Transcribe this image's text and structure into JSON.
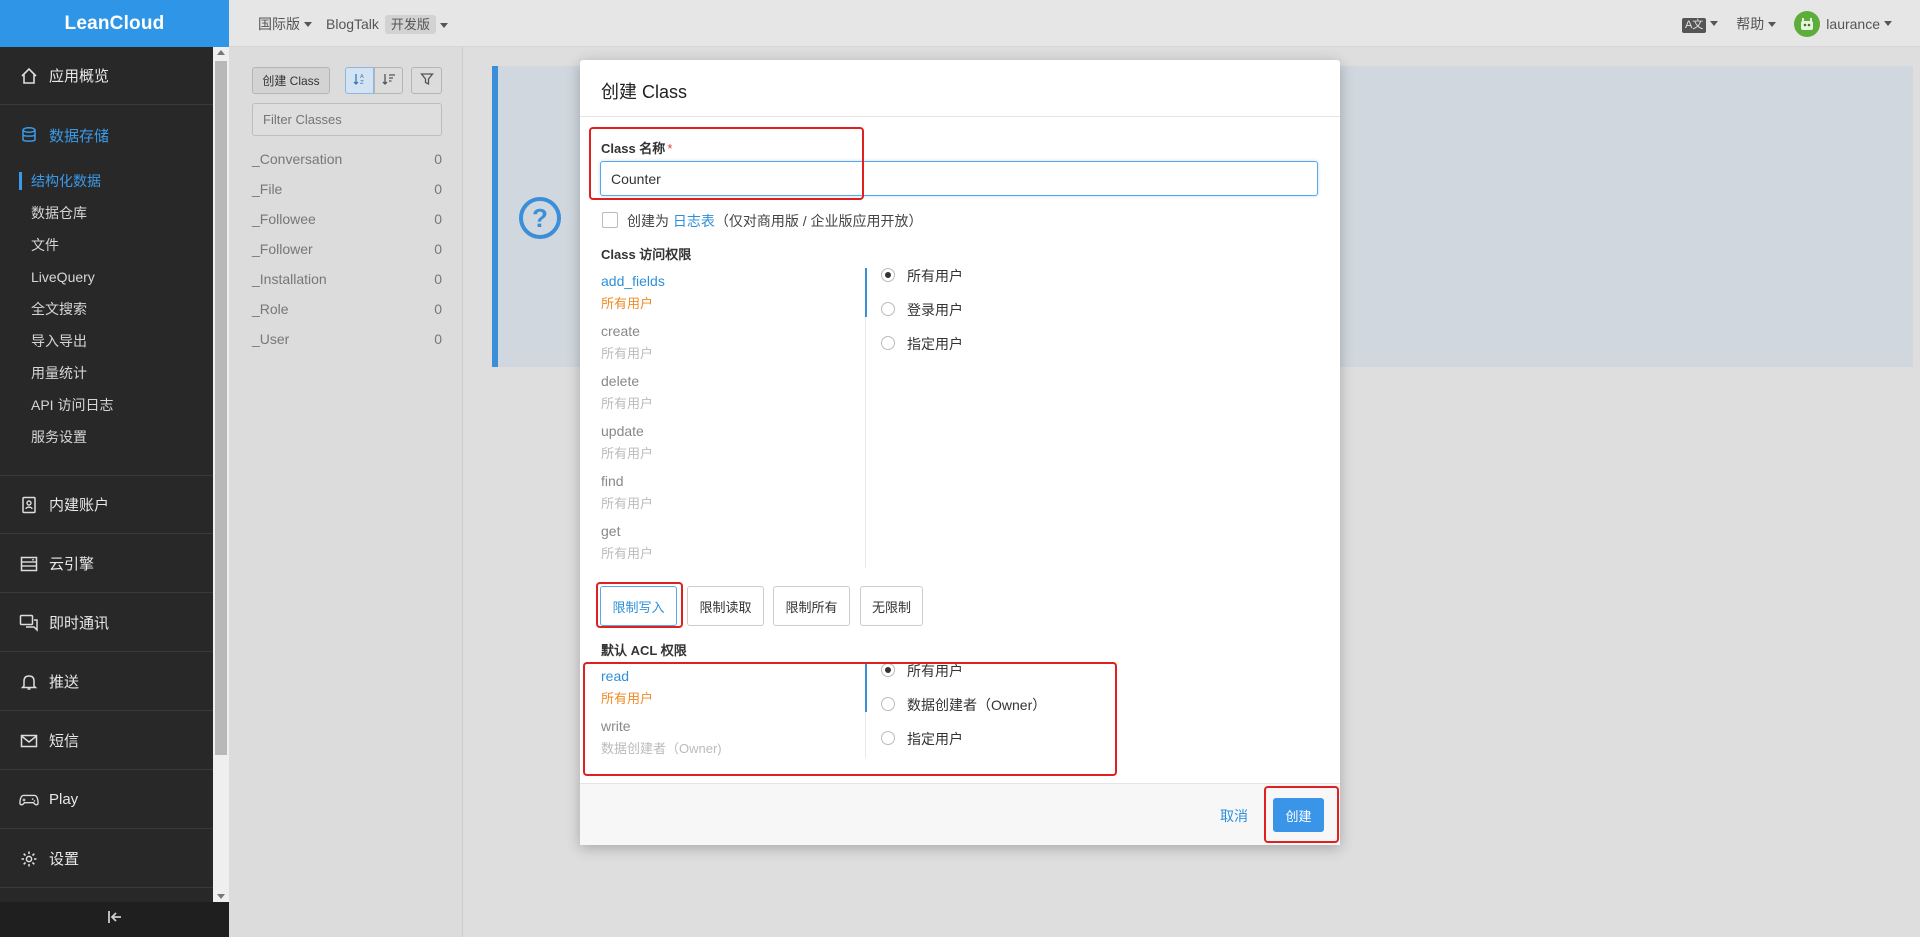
{
  "app": {
    "logo": "LeanCloud"
  },
  "topbar": {
    "region": "国际版",
    "app_name": "BlogTalk",
    "env_badge": "开发版",
    "lang_icon": "A文",
    "help": "帮助",
    "user": "laurance"
  },
  "sidebar": {
    "overview": "应用概览",
    "storage": "数据存储",
    "sub_items": [
      "结构化数据",
      "数据仓库",
      "文件",
      "LiveQuery",
      "全文搜索",
      "导入导出",
      "用量统计",
      "API 访问日志",
      "服务设置"
    ],
    "accounts": "内建账户",
    "engine": "云引擎",
    "im": "即时通讯",
    "push": "推送",
    "sms": "短信",
    "play": "Play",
    "settings": "设置",
    "collapse_icon": "collapse-left-icon"
  },
  "classes_panel": {
    "create_label": "创建 Class",
    "filter_placeholder": "Filter Classes",
    "items": [
      {
        "name": "_Conversation",
        "count": "0"
      },
      {
        "name": "_File",
        "count": "0"
      },
      {
        "name": "_Followee",
        "count": "0"
      },
      {
        "name": "_Follower",
        "count": "0"
      },
      {
        "name": "_Installation",
        "count": "0"
      },
      {
        "name": "_Role",
        "count": "0"
      },
      {
        "name": "_User",
        "count": "0"
      }
    ]
  },
  "modal": {
    "title": "创建 Class",
    "name_label": "Class 名称",
    "required_mark": "*",
    "name_value": "Counter",
    "log_prefix": "创建为",
    "log_link": "日志表",
    "log_suffix": "（仅对商用版 / 企业版应用开放）",
    "access_title": "Class 访问权限",
    "permissions": [
      {
        "name": "add_fields",
        "value": "所有用户"
      },
      {
        "name": "create",
        "value": "所有用户"
      },
      {
        "name": "delete",
        "value": "所有用户"
      },
      {
        "name": "update",
        "value": "所有用户"
      },
      {
        "name": "find",
        "value": "所有用户"
      },
      {
        "name": "get",
        "value": "所有用户"
      }
    ],
    "access_options": [
      "所有用户",
      "登录用户",
      "指定用户"
    ],
    "presets": [
      "限制写入",
      "限制读取",
      "限制所有",
      "无限制"
    ],
    "acl_title": "默认 ACL 权限",
    "acl_perms": [
      {
        "name": "read",
        "value": "所有用户"
      },
      {
        "name": "write",
        "value": "数据创建者（Owner)"
      }
    ],
    "acl_options": [
      "所有用户",
      "数据创建者（Owner）",
      "指定用户"
    ],
    "cancel": "取消",
    "create": "创建"
  }
}
